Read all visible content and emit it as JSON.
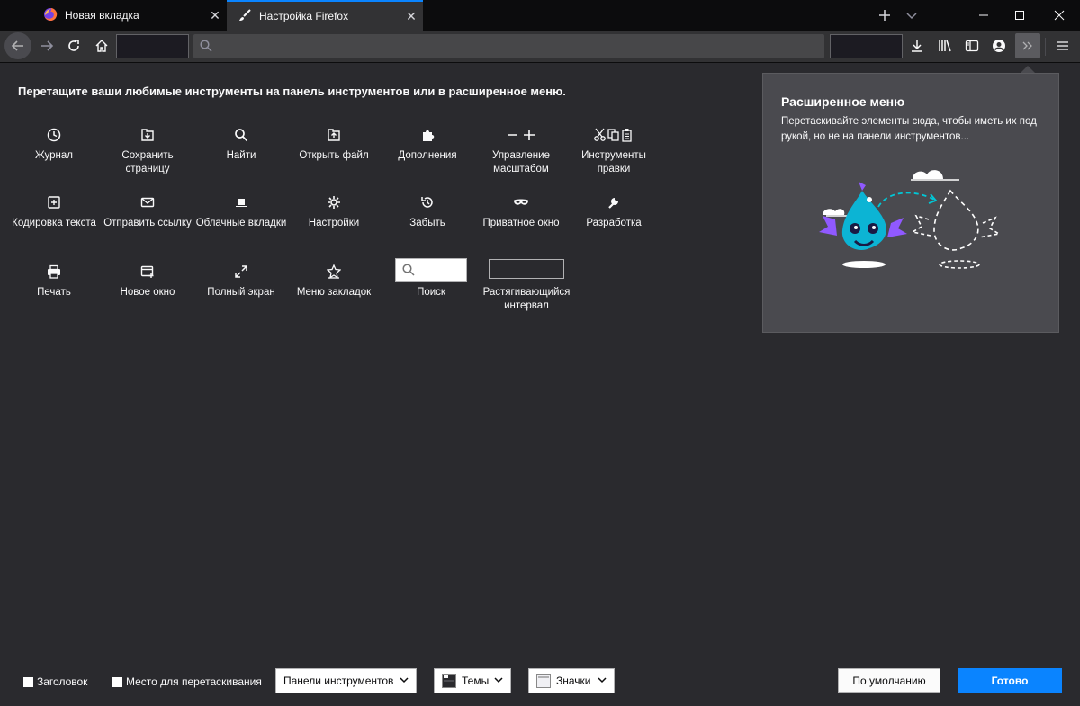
{
  "tabs": [
    {
      "title": "Новая вкладка",
      "icon": "firefox-logo-icon"
    },
    {
      "title": "Настройка Firefox",
      "icon": "paintbrush-icon",
      "active": true
    }
  ],
  "instructions": "Перетащите ваши любимые инструменты на панель инструментов или в расширенное меню.",
  "palette": [
    {
      "label": "Журнал",
      "icon": "history-icon"
    },
    {
      "label": "Сохранить страницу",
      "icon": "save-page-icon"
    },
    {
      "label": "Найти",
      "icon": "find-icon"
    },
    {
      "label": "Открыть файл",
      "icon": "open-file-icon"
    },
    {
      "label": "Дополнения",
      "icon": "addons-icon"
    },
    {
      "label": "Управление масштабом",
      "icon": "zoom-controls-icon"
    },
    {
      "label": "Инструменты правки",
      "icon": "edit-controls-icon"
    },
    {
      "label": "Кодировка текста",
      "icon": "text-encoding-icon"
    },
    {
      "label": "Отправить ссылку",
      "icon": "email-link-icon"
    },
    {
      "label": "Облачные вкладки",
      "icon": "synced-tabs-icon"
    },
    {
      "label": "Настройки",
      "icon": "preferences-icon"
    },
    {
      "label": "Забыть",
      "icon": "forget-icon"
    },
    {
      "label": "Приватное окно",
      "icon": "private-window-icon"
    },
    {
      "label": "Разработка",
      "icon": "developer-icon"
    },
    {
      "label": "Печать",
      "icon": "print-icon"
    },
    {
      "label": "Новое окно",
      "icon": "new-window-icon"
    },
    {
      "label": "Полный экран",
      "icon": "fullscreen-icon"
    },
    {
      "label": "Меню закладок",
      "icon": "bookmarks-menu-icon"
    },
    {
      "label": "Поиск",
      "icon": "search-widget"
    },
    {
      "label": "Растягивающийся интервал",
      "icon": "flexible-space-widget"
    }
  ],
  "overflow_panel": {
    "title": "Расширенное меню",
    "description": "Перетаскивайте элементы сюда, чтобы иметь их под рукой, но не на панели инструментов..."
  },
  "footer": {
    "title_bar_label": "Заголовок",
    "drag_space_label": "Место для перетаскивания",
    "toolbars_label": "Панели инструментов",
    "themes_label": "Темы",
    "density_label": "Значки",
    "restore_defaults_label": "По умолчанию",
    "done_label": "Готово"
  },
  "colors": {
    "background": "#2a2a2e",
    "tabbar": "#0c0c0d",
    "accent": "#0a84ff",
    "panel": "#4a4a4f"
  }
}
